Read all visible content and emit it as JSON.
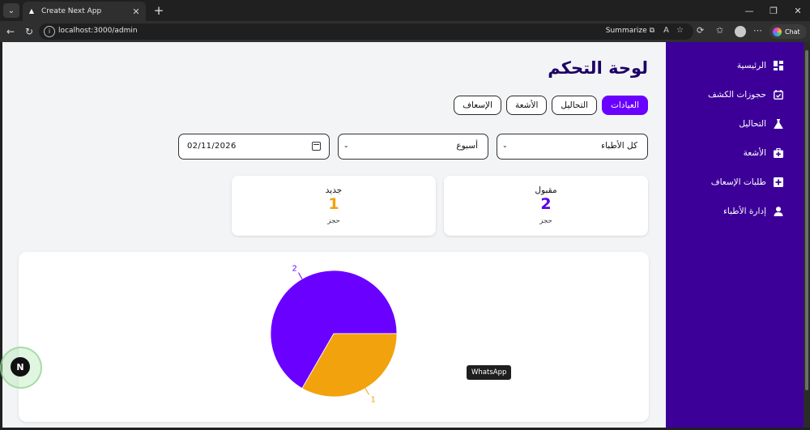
{
  "browser": {
    "tab_title": "Create Next App",
    "url": "localhost:3000/admin",
    "summarize_label": "Summarize",
    "chat_label": "Chat"
  },
  "colors": {
    "primary": "#6a00ff",
    "sidebar": "#3c0099",
    "title": "#1c0066",
    "accepted": "#5a00e6",
    "new": "#f2a20c",
    "slice_orange": "#f2a20c"
  },
  "sidebar": {
    "items": [
      {
        "label": "الرئيسية",
        "icon": "dashboard-icon"
      },
      {
        "label": "حجوزات الكشف",
        "icon": "calendar-check-icon"
      },
      {
        "label": "التحاليل",
        "icon": "flask-icon"
      },
      {
        "label": "الأشعة",
        "icon": "medkit-icon"
      },
      {
        "label": "طلبات الإسعاف",
        "icon": "plus-square-icon"
      },
      {
        "label": "إدارة الأطباء",
        "icon": "user-icon"
      }
    ]
  },
  "header": {
    "title": "لوحة التحكم"
  },
  "tabs": [
    {
      "label": "العيادات",
      "active": true
    },
    {
      "label": "التحاليل",
      "active": false
    },
    {
      "label": "الأشعة",
      "active": false
    },
    {
      "label": "الإسعاف",
      "active": false
    }
  ],
  "filters": {
    "doctor": "كل الأطباء",
    "period": "أسبوع",
    "date": "02/11/2026"
  },
  "stats": {
    "accepted": {
      "title": "مقبول",
      "value": "2",
      "unit": "حجز"
    },
    "new": {
      "title": "جديد",
      "value": "1",
      "unit": "حجز"
    }
  },
  "chart_data": {
    "type": "pie",
    "categories": [
      "مقبول",
      "جديد"
    ],
    "values": [
      2,
      1
    ],
    "data_labels": [
      "2",
      "1"
    ],
    "colors": [
      "#6a00ff",
      "#f2a20c"
    ]
  },
  "overlays": {
    "whatsapp_tooltip": "WhatsApp",
    "next_badge": "N"
  }
}
